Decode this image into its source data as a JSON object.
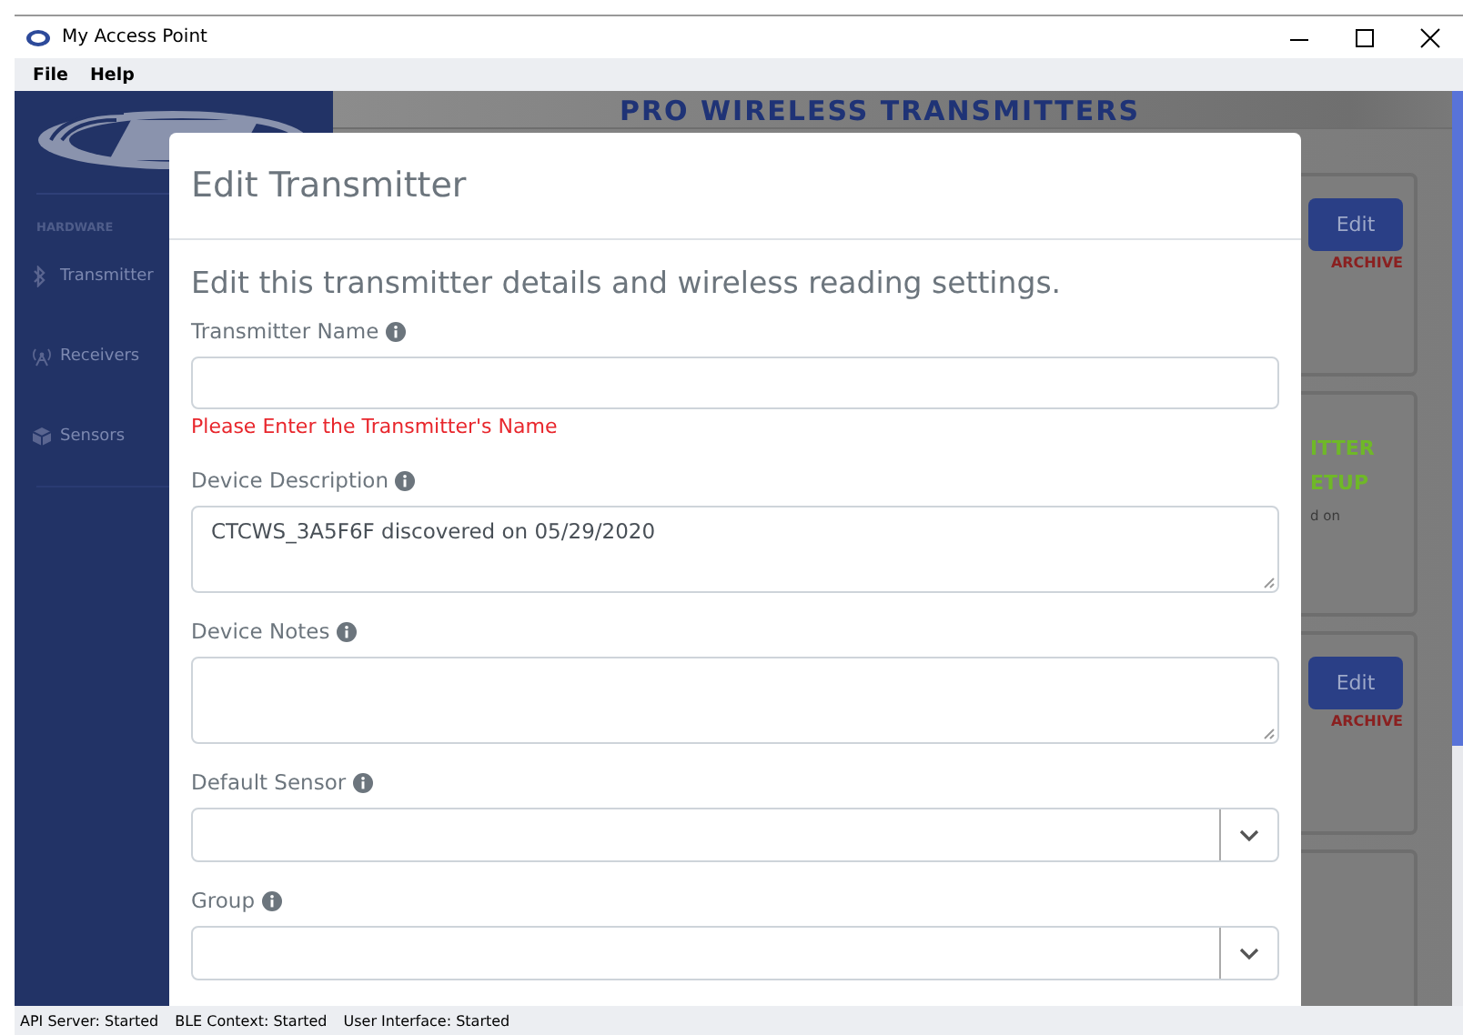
{
  "window": {
    "title": "My Access Point"
  },
  "menu": [
    "File",
    "Help"
  ],
  "sidebar": {
    "section": "HARDWARE",
    "items": [
      {
        "label": "Transmitter"
      },
      {
        "label": "Receivers"
      },
      {
        "label": "Sensors"
      }
    ]
  },
  "page": {
    "heading": "PRO WIRELESS TRANSMITTERS",
    "cards": [
      {
        "kind": "actions",
        "button": "Edit",
        "link": "ARCHIVE"
      },
      {
        "kind": "status",
        "lines": [
          "ITTER",
          "ETUP"
        ],
        "note": "d on"
      },
      {
        "kind": "actions",
        "button": "Edit",
        "link": "ARCHIVE"
      },
      {
        "kind": "blank"
      }
    ]
  },
  "dialog": {
    "title": "Edit Transmitter",
    "intro": "Edit this transmitter details and wireless reading settings.",
    "fields": [
      {
        "kind": "text",
        "label": "Transmitter Name",
        "error": "Please Enter the Transmitter's Name"
      },
      {
        "kind": "textarea",
        "label": "Device Description",
        "value": "CTCWS_3A5F6F discovered on 05/29/2020"
      },
      {
        "kind": "textarea",
        "label": "Device Notes"
      },
      {
        "kind": "select",
        "label": "Default Sensor"
      },
      {
        "kind": "select",
        "label": "Group"
      }
    ]
  },
  "status_bar": [
    "API Server: Started",
    "BLE Context: Started",
    "User Interface: Started"
  ]
}
